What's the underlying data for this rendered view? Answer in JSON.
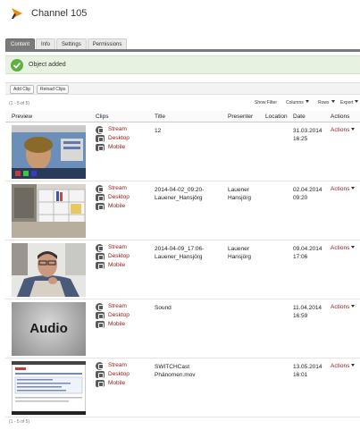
{
  "header": {
    "title": "Channel 105"
  },
  "tabs": [
    {
      "label": "Content",
      "active": true
    },
    {
      "label": "Info",
      "active": false
    },
    {
      "label": "Settings",
      "active": false
    },
    {
      "label": "Permissions",
      "active": false
    }
  ],
  "notice": {
    "text": "Object added"
  },
  "toolbar": {
    "add_clip": "Add Clip",
    "reload_clips": "Reload Clips"
  },
  "pagination": {
    "top": "(1 - 5 of 5)",
    "bottom": "(1 - 5 of 5)"
  },
  "filters": {
    "show_filter": "Show Filter",
    "columns": "Columns",
    "rows": "Rows",
    "export": "Export"
  },
  "columns": {
    "preview": "Preview",
    "clips": "Clips",
    "title": "Title",
    "presenter": "Presenter",
    "location": "Location",
    "date": "Date",
    "actions": "Actions"
  },
  "clip_labels": {
    "stream": "Stream",
    "desktop": "Desktop",
    "mobile": "Mobile"
  },
  "rows": [
    {
      "thumb": "landscape-thumbnail",
      "title": "12",
      "presenter": "",
      "location": "",
      "date": "31.03.2014",
      "time": "16:25",
      "action": "Actions"
    },
    {
      "thumb": "shelf-room-thumbnail",
      "title": "2014-04-02_09:20-",
      "title2": "Lauener_Hansjörg",
      "presenter": "Lauener",
      "presenter2": "Hansjörg",
      "location": "",
      "date": "02.04.2014",
      "time": "09:20",
      "action": "Actions"
    },
    {
      "thumb": "person-thumbnail",
      "title": "2014-04-09_17:06-",
      "title2": "Lauener_Hansjörg",
      "presenter": "Lauener",
      "presenter2": "Hansjörg",
      "location": "",
      "date": "09.04.2014",
      "time": "17:06",
      "action": "Actions"
    },
    {
      "thumb": "audio-thumbnail",
      "thumb_text": "Audio",
      "title": "Sound",
      "presenter": "",
      "location": "",
      "date": "11.04.2014",
      "time": "16:59",
      "action": "Actions"
    },
    {
      "thumb": "screenshot-thumbnail",
      "title": "SWITCHCast",
      "title2": "Phänomen.mov",
      "presenter": "",
      "location": "",
      "date": "13.05.2014",
      "time": "16:01",
      "action": "Actions"
    }
  ],
  "colors": {
    "accent": "#8b1a1a",
    "success": "#5fb03f",
    "logo": "#f08c00",
    "logo_dark": "#2a2a4a"
  }
}
